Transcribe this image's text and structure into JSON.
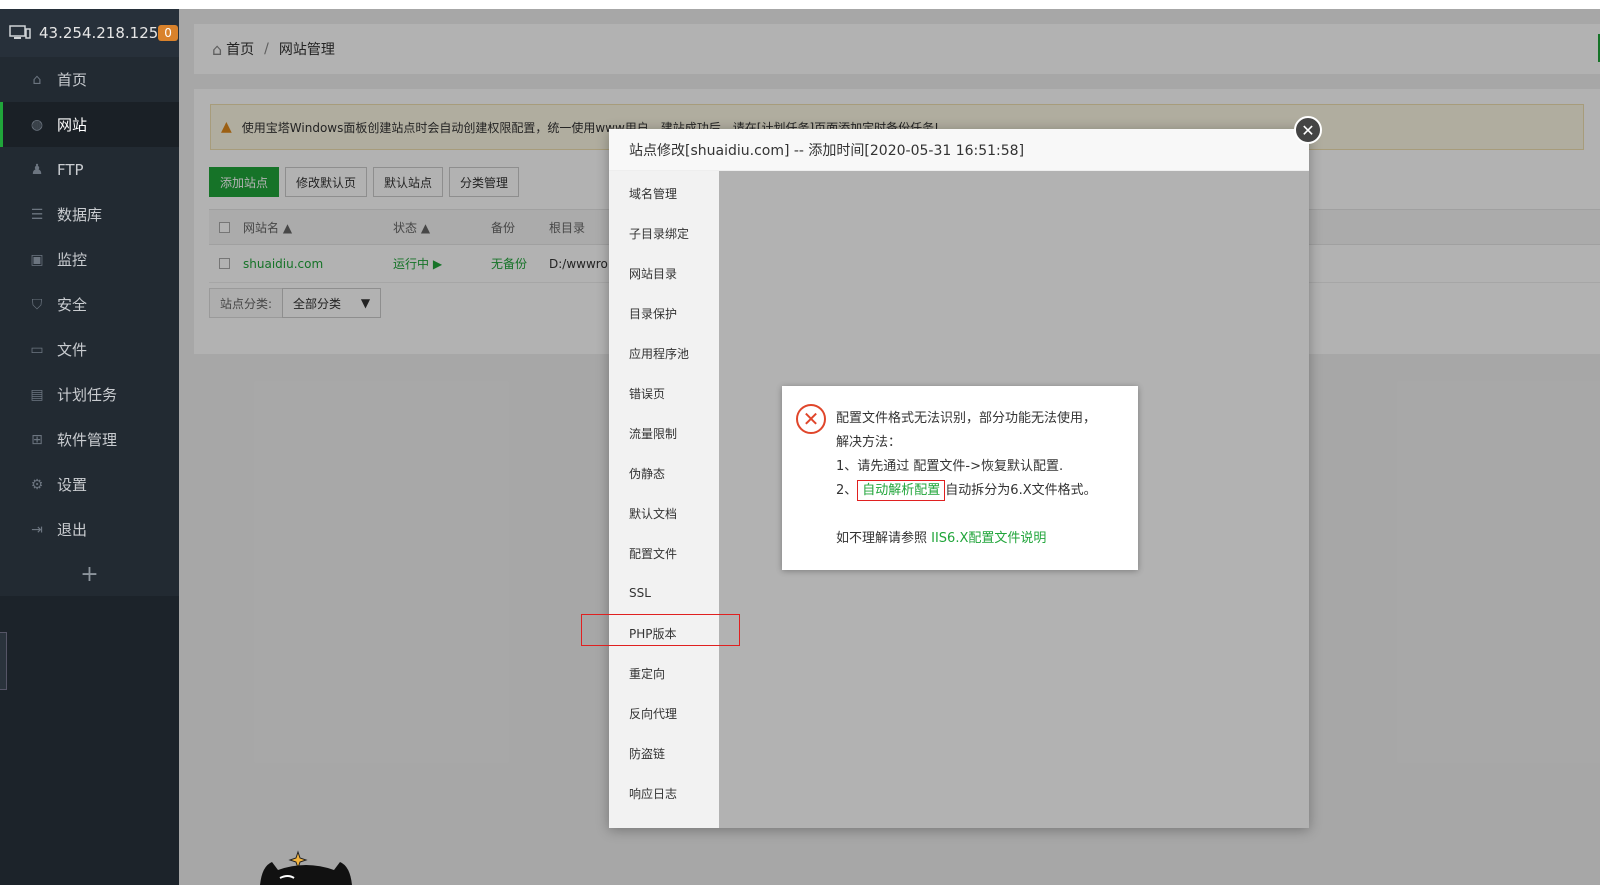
{
  "sidebar": {
    "ip": "43.254.218.125",
    "badge": "0",
    "items": [
      {
        "label": "首页",
        "icon": "home-icon"
      },
      {
        "label": "网站",
        "icon": "globe-icon"
      },
      {
        "label": "FTP",
        "icon": "ftp-icon"
      },
      {
        "label": "数据库",
        "icon": "database-icon"
      },
      {
        "label": "监控",
        "icon": "monitor-icon"
      },
      {
        "label": "安全",
        "icon": "shield-icon"
      },
      {
        "label": "文件",
        "icon": "folder-icon"
      },
      {
        "label": "计划任务",
        "icon": "calendar-icon"
      },
      {
        "label": "软件管理",
        "icon": "grid-icon"
      },
      {
        "label": "设置",
        "icon": "gear-icon"
      },
      {
        "label": "退出",
        "icon": "logout-icon"
      }
    ],
    "plus": "+"
  },
  "breadcrumb": {
    "home": "首页",
    "sep": "/",
    "current": "网站管理"
  },
  "notice": {
    "text": "使用宝塔Windows面板创建站点时会自动创建权限配置，统一使用www用户，建站成功后，请在[计划任务]页面添加定时备份任务!"
  },
  "toolbar": {
    "add": "添加站点",
    "edit_default": "修改默认页",
    "default_site": "默认站点",
    "category": "分类管理"
  },
  "table": {
    "headers": [
      "网站名 ▲",
      "状态 ▲",
      "备份",
      "根目录"
    ],
    "rows": [
      {
        "name": "shuaidiu.com",
        "status": "运行中 ▶",
        "backup": "无备份",
        "root": "D:/wwwro"
      }
    ]
  },
  "category_filter": {
    "label": "站点分类:",
    "value": "全部分类",
    "arrow": "▼"
  },
  "modal": {
    "title": "站点修改[shuaidiu.com] -- 添加时间[2020-05-31 16:51:58]",
    "close": "✕",
    "nav": [
      "域名管理",
      "子目录绑定",
      "网站目录",
      "目录保护",
      "应用程序池",
      "错误页",
      "流量限制",
      "伪静态",
      "默认文档",
      "配置文件",
      "SSL",
      "PHP版本",
      "重定向",
      "反向代理",
      "防盗链",
      "响应日志"
    ]
  },
  "error_dialog": {
    "icon": "✕",
    "line1": "配置文件格式无法识别，部分功能无法使用，",
    "line2": "解决方法：",
    "line3": "1、请先通过 配置文件->恢复默认配置.",
    "line4_prefix": "2、",
    "line4_link": "自动解析配置",
    "line4_suffix": "自动拆分为6.X文件格式。",
    "line5_prefix": "如不理解请参照 ",
    "line5_link": "IIS6.X配置文件说明"
  },
  "colors": {
    "accent": "#20a53a",
    "sidebar_bg": "#1c232a",
    "badge": "#d9822b",
    "error": "#e0462b"
  }
}
